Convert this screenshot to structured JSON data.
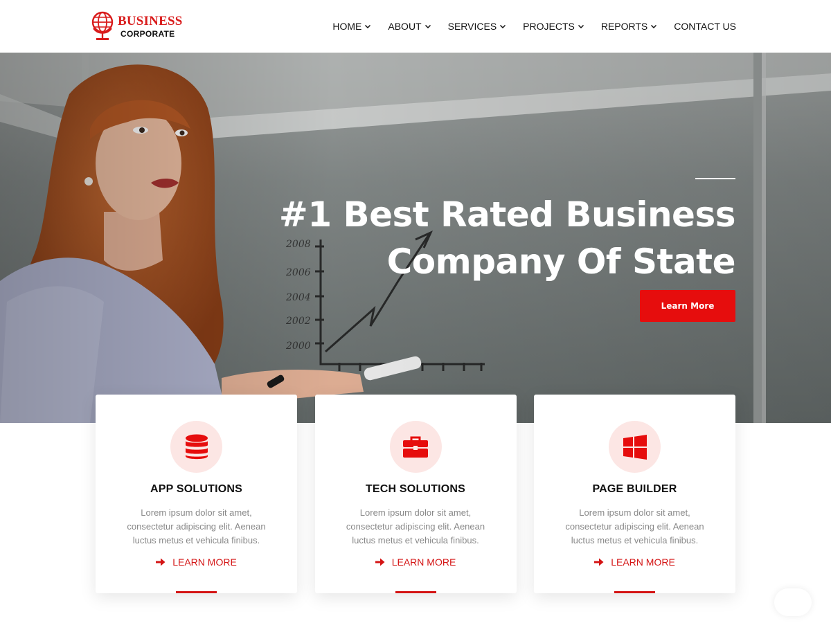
{
  "colors": {
    "accent": "#e60d0d",
    "icon_bg": "#fce6e4",
    "text_muted": "#888888"
  },
  "header": {
    "logo": {
      "line1": "BUSINESS",
      "line2": "CORPORATE",
      "icon": "globe-stand-icon"
    },
    "nav": [
      {
        "label": "HOME",
        "has_dropdown": true
      },
      {
        "label": "ABOUT",
        "has_dropdown": true
      },
      {
        "label": "SERVICES",
        "has_dropdown": true
      },
      {
        "label": "PROJECTS",
        "has_dropdown": true
      },
      {
        "label": "REPORTS",
        "has_dropdown": true
      },
      {
        "label": "CONTACT US",
        "has_dropdown": false
      }
    ]
  },
  "hero": {
    "title": "#1 Best Rated Business Company Of State",
    "button_label": "Learn More",
    "whiteboard": {
      "years": [
        "2008",
        "2006",
        "2004",
        "2002",
        "2000"
      ]
    }
  },
  "cards": [
    {
      "icon": "database-icon",
      "title": "APP SOLUTIONS",
      "text": "Lorem ipsum dolor sit amet, consectetur adipiscing elit. Aenean luctus metus et vehicula finibus.",
      "link": "LEARN MORE"
    },
    {
      "icon": "briefcase-icon",
      "title": "TECH SOLUTIONS",
      "text": "Lorem ipsum dolor sit amet, consectetur adipiscing elit. Aenean luctus metus et vehicula finibus.",
      "link": "LEARN MORE"
    },
    {
      "icon": "windows-icon",
      "title": "PAGE BUILDER",
      "text": "Lorem ipsum dolor sit amet, consectetur adipiscing elit. Aenean luctus metus et vehicula finibus.",
      "link": "LEARN MORE"
    }
  ]
}
